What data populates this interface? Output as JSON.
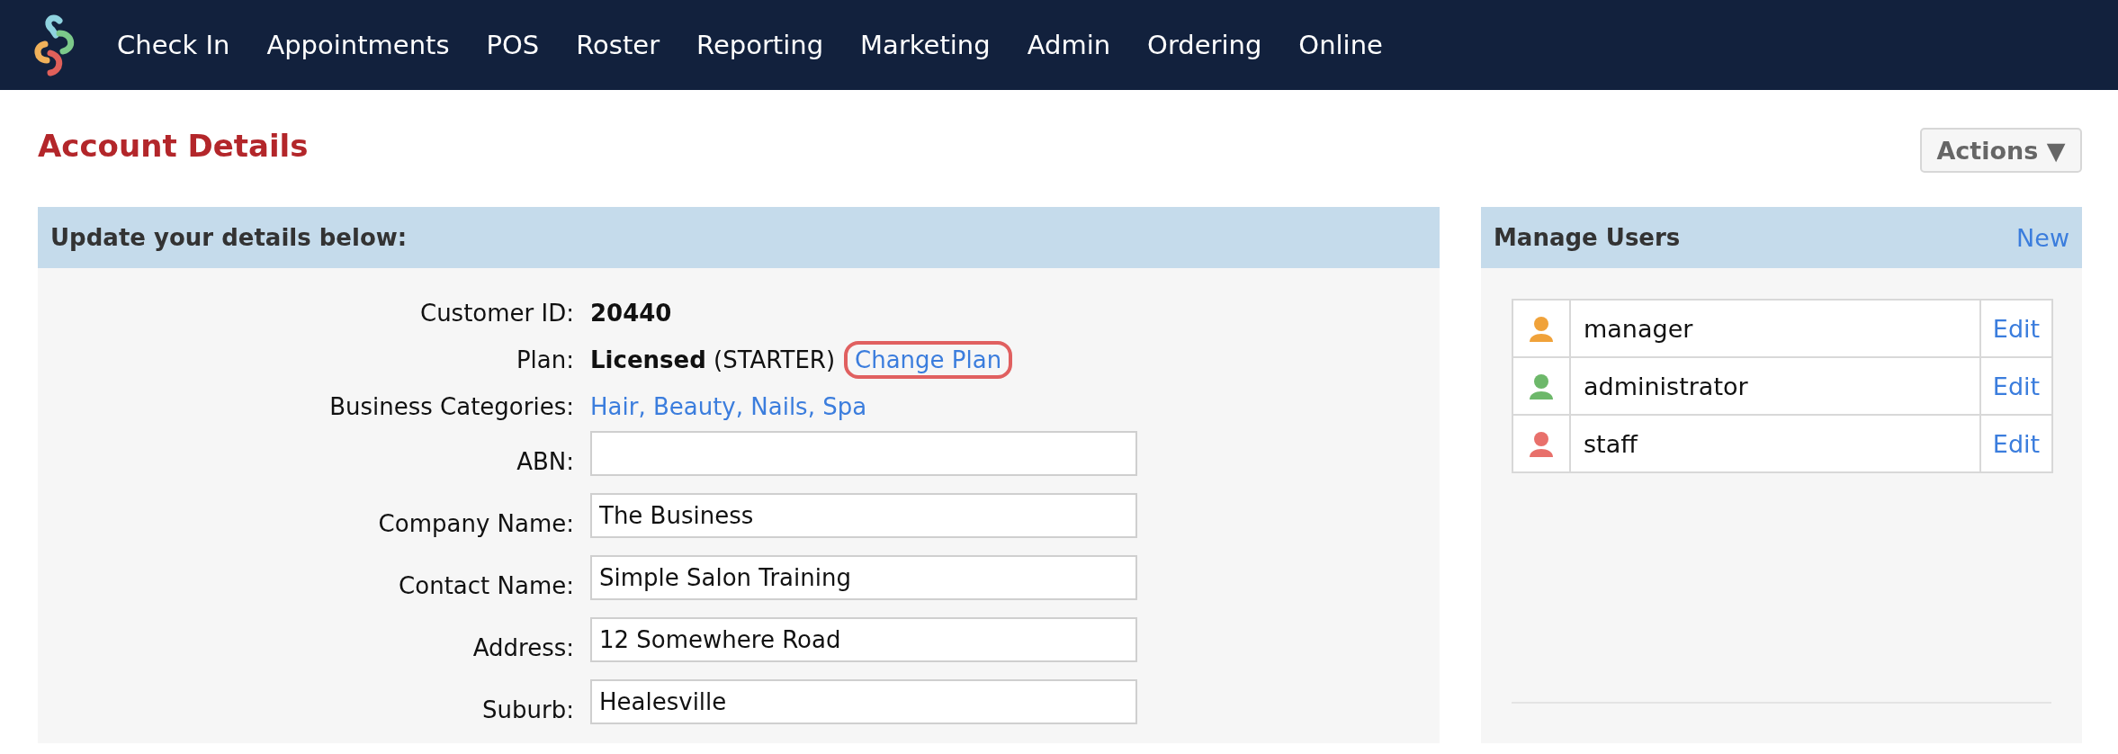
{
  "nav": {
    "items": [
      {
        "label": "Check In"
      },
      {
        "label": "Appointments"
      },
      {
        "label": "POS"
      },
      {
        "label": "Roster"
      },
      {
        "label": "Reporting"
      },
      {
        "label": "Marketing"
      },
      {
        "label": "Admin"
      },
      {
        "label": "Ordering"
      },
      {
        "label": "Online"
      }
    ]
  },
  "page": {
    "title": "Account Details",
    "actions_button": "Actions ▼"
  },
  "details": {
    "header": "Update your details below:",
    "fields": [
      {
        "kind": "text",
        "label": "Customer ID:",
        "value": "20440"
      },
      {
        "kind": "plan",
        "label": "Plan:",
        "value": "**Licensed** (STARTER)",
        "link": "Change Plan",
        "highlighted": true
      },
      {
        "kind": "link",
        "label": "Business Categories:",
        "value": "Hair, Beauty, Nails, Spa"
      },
      {
        "kind": "input",
        "label": "ABN:"
      },
      {
        "kind": "input",
        "label": "Company Name:",
        "value": "The Business"
      },
      {
        "kind": "input",
        "label": "Contact Name:",
        "value": "Simple Salon Training"
      },
      {
        "kind": "input",
        "label": "Address:",
        "value": "12 Somewhere Road"
      },
      {
        "kind": "input",
        "label": "Suburb:",
        "value": "Healesville"
      }
    ]
  },
  "users": {
    "header": "Manage Users",
    "new_link": "New",
    "rows": [
      {
        "name": "manager",
        "color": "#f0a23a",
        "action": "Edit"
      },
      {
        "name": "administrator",
        "color": "#6db86a",
        "action": "Edit"
      },
      {
        "name": "staff",
        "color": "#e8706b",
        "action": "Edit"
      }
    ]
  }
}
